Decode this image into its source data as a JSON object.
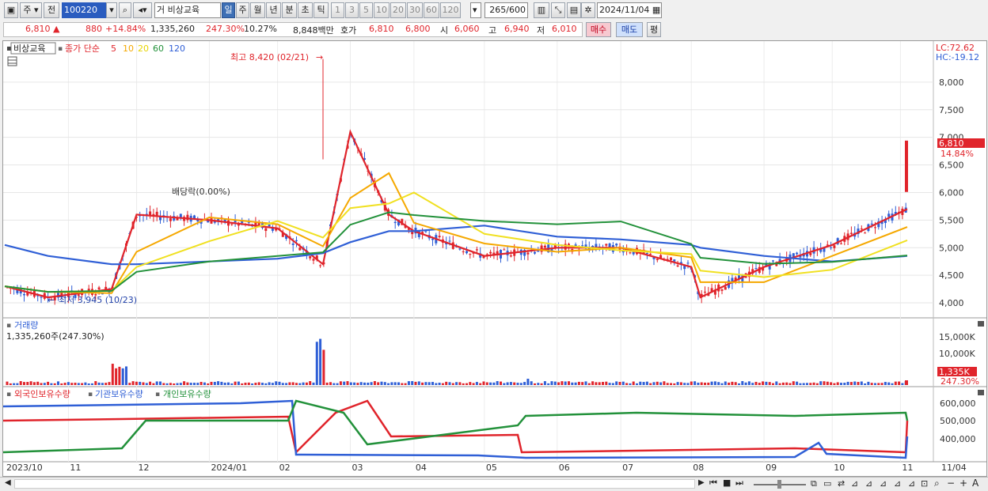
{
  "toolbar": {
    "market": "주",
    "prev_btn": "전",
    "code": "100220",
    "trade_mark": "거",
    "stock_name": "비상교육",
    "periods": [
      "일",
      "주",
      "월",
      "년",
      "분",
      "초",
      "틱"
    ],
    "active_period": "일",
    "intervals": [
      "1",
      "3",
      "5",
      "10",
      "20",
      "30",
      "60",
      "120"
    ],
    "count": "265",
    "count_total": "/600",
    "date": "2024/11/04"
  },
  "quote": {
    "price": "6,810",
    "change": "880",
    "change_pct": "+14.84%",
    "volume": "1,335,260",
    "volume_ratio": "247.30%",
    "turnover": "10.27%",
    "amount": "8,848백만",
    "bid_label": "호가",
    "ask_price": "6,810",
    "bid_price": "6,800",
    "open_label": "시",
    "open": "6,060",
    "high_label": "고",
    "high": "6,940",
    "low_label": "저",
    "low": "6,010",
    "buy_btn": "매수",
    "sell_btn": "매도",
    "eval_btn": "평"
  },
  "price_panel": {
    "stock_tag": "비상교육",
    "ma_label": "종가 단순",
    "ma_periods": [
      "5",
      "10",
      "20",
      "60",
      "120"
    ],
    "ma_colors": [
      "#e0242b",
      "#f5a800",
      "#f0e020",
      "#22913a",
      "#2f5fd6"
    ],
    "high_note": "최고 8,420 (02/21)",
    "low_note": "최저 3,945 (10/23)",
    "dividend_note": "배당락(0.00%)",
    "lc": "LC:72.62",
    "hc": "HC:-19.12",
    "price_badge": "6,810",
    "pct_badge": "14.84%",
    "y_ticks": [
      "8,000",
      "7,500",
      "7,000",
      "6,500",
      "6,000",
      "5,500",
      "5,000",
      "4,500",
      "4,000"
    ]
  },
  "volume_panel": {
    "title": "거래량",
    "info": "1,335,260주(247.30%)",
    "y_ticks": [
      "15,000K",
      "10,000K"
    ],
    "badge": "1,335K",
    "badge_pct": "247.30%"
  },
  "holding_panel": {
    "legend": [
      "외국인보유수량",
      "기관보유수량",
      "개인보유수량"
    ],
    "legend_colors": [
      "#e0242b",
      "#2f5fd6",
      "#22913a"
    ],
    "y_ticks": [
      "600,000",
      "500,000",
      "400,000"
    ]
  },
  "x_axis": {
    "labels": [
      "2023/10",
      "11",
      "12",
      "2024/01",
      "02",
      "03",
      "04",
      "05",
      "06",
      "07",
      "08",
      "09",
      "10",
      "11",
      "11/04"
    ]
  },
  "chart_data": {
    "type": "line",
    "title": "",
    "x": [
      "2023/10/04",
      "2023/10/23",
      "2023/11/20",
      "2023/12/01",
      "2024/01/02",
      "2024/02/01",
      "2024/02/21",
      "2024/03/04",
      "2024/03/21",
      "2024/04/01",
      "2024/05/02",
      "2024/06/03",
      "2024/07/01",
      "2024/08/01",
      "2024/08/05",
      "2024/09/02",
      "2024/10/02",
      "2024/11/04"
    ],
    "series": [
      {
        "name": "5",
        "values": [
          4300,
          4100,
          4250,
          5600,
          5500,
          5350,
          4700,
          7100,
          5600,
          5300,
          4850,
          5000,
          5000,
          4650,
          4100,
          4650,
          5050,
          5700
        ]
      },
      {
        "name": "120",
        "values": [
          5050,
          4850,
          4700,
          4700,
          4750,
          4800,
          4900,
          5100,
          5300,
          5300,
          5400,
          5200,
          5150,
          5050,
          5000,
          4850,
          4750,
          4850
        ]
      }
    ],
    "ylim": [
      3800,
      8600
    ],
    "highlights": {
      "high": 8420,
      "high_date": "02/21",
      "low": 3945,
      "low_date": "10/23",
      "last_close": 6810
    }
  }
}
